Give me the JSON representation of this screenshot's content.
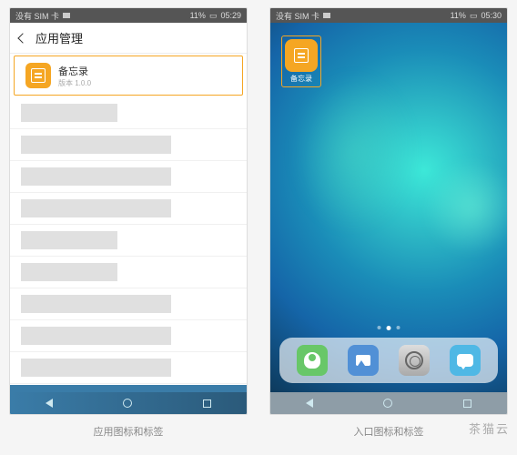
{
  "left": {
    "status": {
      "sim": "没有 SIM 卡",
      "battery": "11%",
      "time": "05:29"
    },
    "header": {
      "title": "应用管理"
    },
    "app": {
      "name": "备忘录",
      "version": "版本 1.0.0"
    },
    "caption": "应用图标和标签"
  },
  "right": {
    "status": {
      "sim": "没有 SIM 卡",
      "battery": "11%",
      "time": "05:30"
    },
    "home_app": {
      "label": "备忘录"
    },
    "caption": "入口图标和标签"
  },
  "watermark": "茶猫云"
}
